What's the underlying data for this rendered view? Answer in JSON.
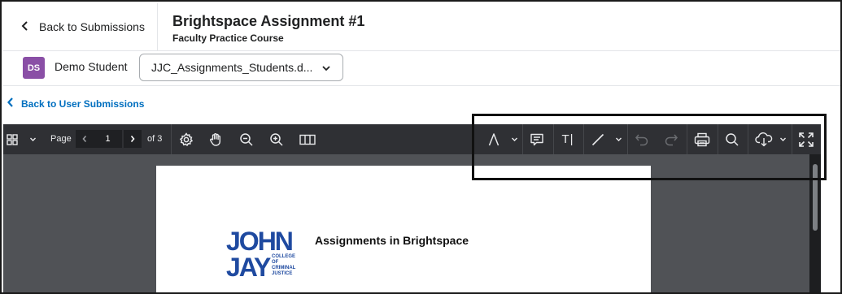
{
  "header": {
    "back_label": "Back to Submissions",
    "title": "Brightspace Assignment #1",
    "course": "Faculty Practice Course"
  },
  "student": {
    "initials": "DS",
    "name": "Demo Student",
    "file_selected": "JJC_Assignments_Students.d...",
    "avatar_color": "#8a4fa6"
  },
  "nav": {
    "back_user_label": "Back to User Submissions",
    "link_color": "#006fbf"
  },
  "toolbar": {
    "page_label": "Page",
    "current_page": "1",
    "of_label": "of 3",
    "text_tool_label": "T|",
    "icons": [
      "thumbnails-icon",
      "settings-icon",
      "pan-hand-icon",
      "zoom-out-icon",
      "zoom-in-icon",
      "page-layout-icon",
      "pen-annotation-icon",
      "comment-icon",
      "text-tool-icon",
      "line-tool-icon",
      "undo-icon",
      "redo-icon",
      "print-icon",
      "search-icon",
      "download-icon",
      "fullscreen-icon"
    ]
  },
  "document": {
    "heading": "Assignments in Brightspace",
    "logo": {
      "line1": "JOHN",
      "line2": "JAY",
      "tagline": [
        "COLLEGE",
        "OF",
        "CRIMINAL",
        "JUSTICE"
      ],
      "color": "#1f4aa0"
    }
  }
}
